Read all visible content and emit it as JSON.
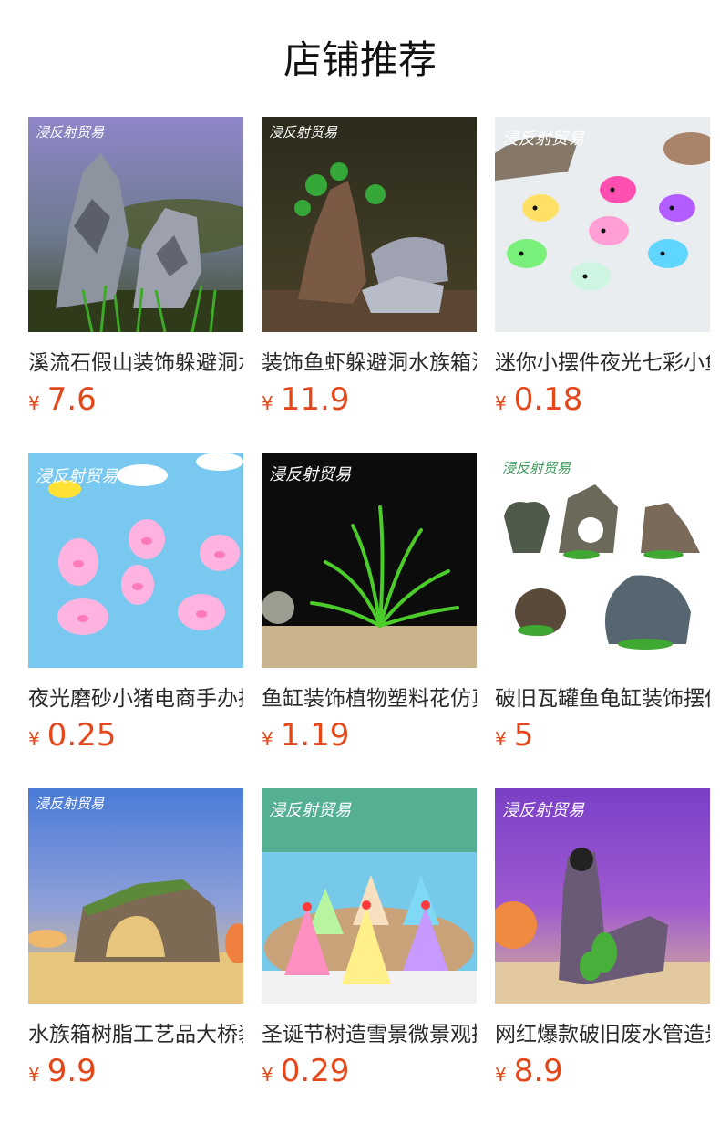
{
  "page": {
    "title": "店铺推荐"
  },
  "currency_symbol": "¥",
  "brand_watermark": "浸反射贸易",
  "products": [
    {
      "name": "溪流石假山装饰躲避洞水族箱造景",
      "price": "7.6",
      "icon": "rock-mountain-aquascape-image"
    },
    {
      "name": "装饰鱼虾躲避洞水族箱沉木造景",
      "price": "11.9",
      "icon": "driftwood-cave-decor-image"
    },
    {
      "name": "迷你小摆件夜光七彩小鱼",
      "price": "0.18",
      "icon": "glow-fish-figurines-image"
    },
    {
      "name": "夜光磨砂小猪电商手办摆件",
      "price": "0.25",
      "icon": "glow-pig-figurines-image"
    },
    {
      "name": "鱼缸装饰植物塑料花仿真水草",
      "price": "1.19",
      "icon": "artificial-aquarium-plant-image"
    },
    {
      "name": "破旧瓦罐鱼龟缸装饰摆件",
      "price": "5",
      "icon": "broken-pottery-decor-image"
    },
    {
      "name": "水族箱树脂工艺品大桥装饰",
      "price": "9.9",
      "icon": "resin-bridge-decor-image"
    },
    {
      "name": "圣诞节树造雪景微景观摆件",
      "price": "0.29",
      "icon": "christmas-tree-figurines-image"
    },
    {
      "name": "网红爆款破旧废水管造景",
      "price": "8.9",
      "icon": "old-pipe-decor-image"
    }
  ]
}
